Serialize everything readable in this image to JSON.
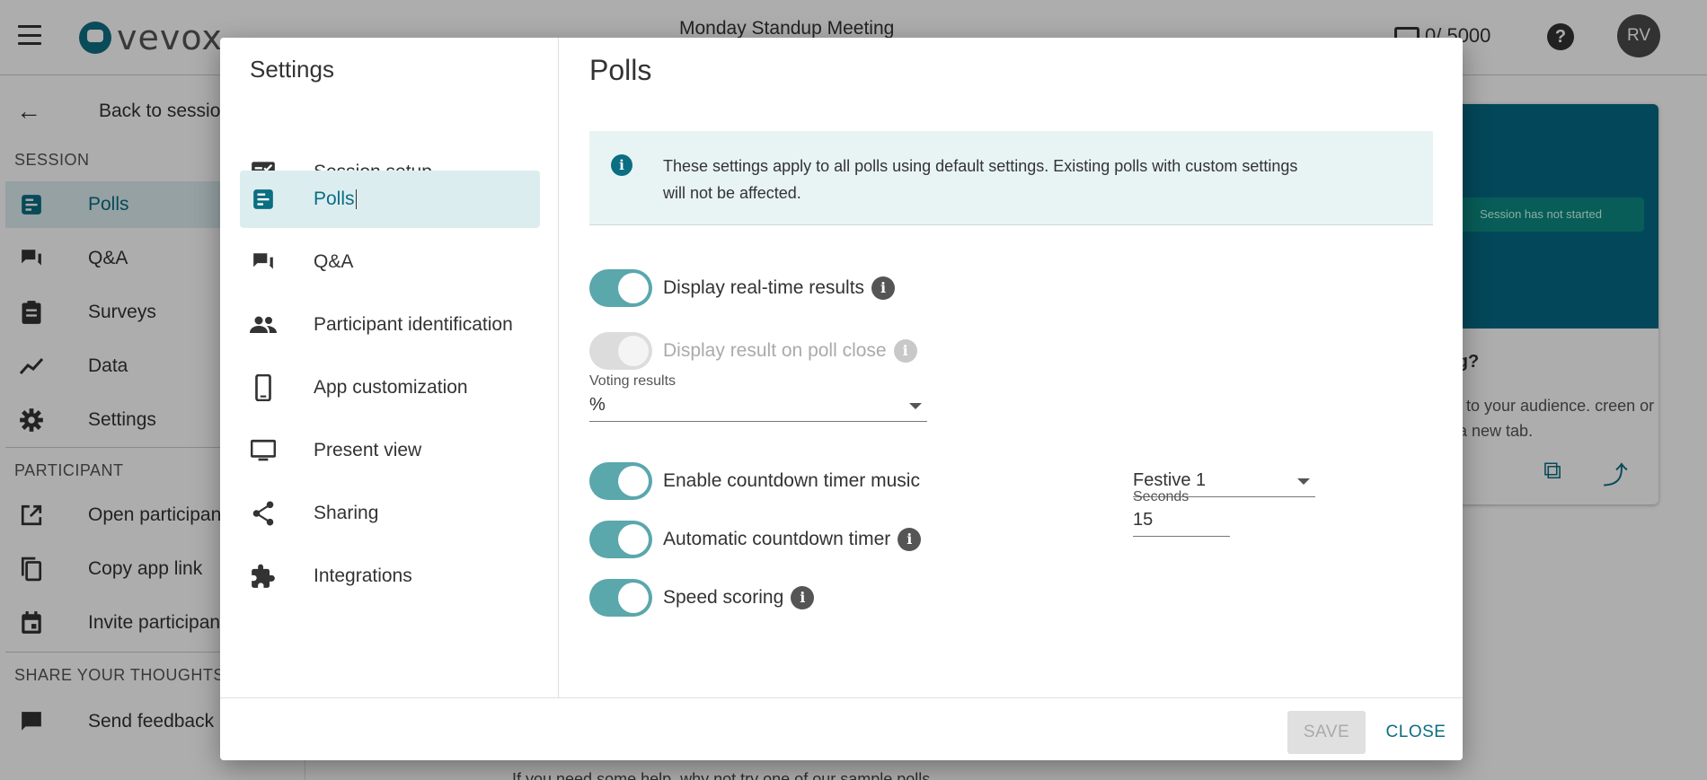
{
  "app": {
    "logo_text": "vevox",
    "session_title": "Monday Standup Meeting",
    "participant_count": "0/ 5000",
    "avatar_initials": "RV",
    "help_glyph": "?"
  },
  "sidebar": {
    "back_label": "Back to sessions",
    "session_heading": "SESSION",
    "session_items": [
      {
        "label": "Polls",
        "icon": "polls-icon"
      },
      {
        "label": "Q&A",
        "icon": "qa-icon"
      },
      {
        "label": "Surveys",
        "icon": "surveys-icon"
      },
      {
        "label": "Data",
        "icon": "data-icon"
      },
      {
        "label": "Settings",
        "icon": "gear-icon"
      }
    ],
    "participant_heading": "PARTICIPANT",
    "participant_items": [
      {
        "label": "Open participant app",
        "icon": "open-external-icon"
      },
      {
        "label": "Copy app link",
        "icon": "copy-icon"
      },
      {
        "label": "Invite participants",
        "icon": "calendar-icon"
      }
    ],
    "feedback_heading": "SHARE YOUR THOUGHTS",
    "feedback_label": "Send feedback"
  },
  "preview": {
    "status_text": "Session has not started",
    "question": "ing?",
    "text": "&A to your audience. creen or in a new tab.",
    "bottom_text": "If you need some help, why not try one of our sample polls"
  },
  "modal": {
    "title": "Settings",
    "nav": [
      {
        "label": "Session setup",
        "icon": "checklist-icon"
      },
      {
        "label": "Polls",
        "icon": "polls-icon"
      },
      {
        "label": "Q&A",
        "icon": "qa-icon"
      },
      {
        "label": "Participant identification",
        "icon": "people-icon"
      },
      {
        "label": "App customization",
        "icon": "phone-icon"
      },
      {
        "label": "Present view",
        "icon": "monitor-icon"
      },
      {
        "label": "Sharing",
        "icon": "share-icon"
      },
      {
        "label": "Integrations",
        "icon": "puzzle-icon"
      }
    ],
    "active_nav": "Polls",
    "pane_title": "Polls",
    "info_text": "These settings apply to all polls using default settings. Existing polls with custom settings will not be affected.",
    "toggles": [
      {
        "label": "Display real-time results",
        "on": true,
        "disabled": false,
        "has_info": true
      },
      {
        "label": "Display result on poll close",
        "on": false,
        "disabled": true,
        "has_info": true
      },
      {
        "label": "Enable countdown timer music",
        "on": true,
        "disabled": false,
        "has_info": false
      },
      {
        "label": "Automatic countdown timer",
        "on": true,
        "disabled": false,
        "has_info": true
      },
      {
        "label": "Speed scoring",
        "on": true,
        "disabled": false,
        "has_info": true
      }
    ],
    "voting_results": {
      "label": "Voting results",
      "value": "%"
    },
    "music_select": {
      "value": "Festive 1"
    },
    "seconds": {
      "label": "Seconds",
      "value": "15"
    },
    "save_label": "SAVE",
    "close_label": "CLOSE"
  },
  "colors": {
    "accent": "#0b6e82",
    "toggle_on": "#5aa7ac",
    "info_bg": "#e8f4f4"
  }
}
